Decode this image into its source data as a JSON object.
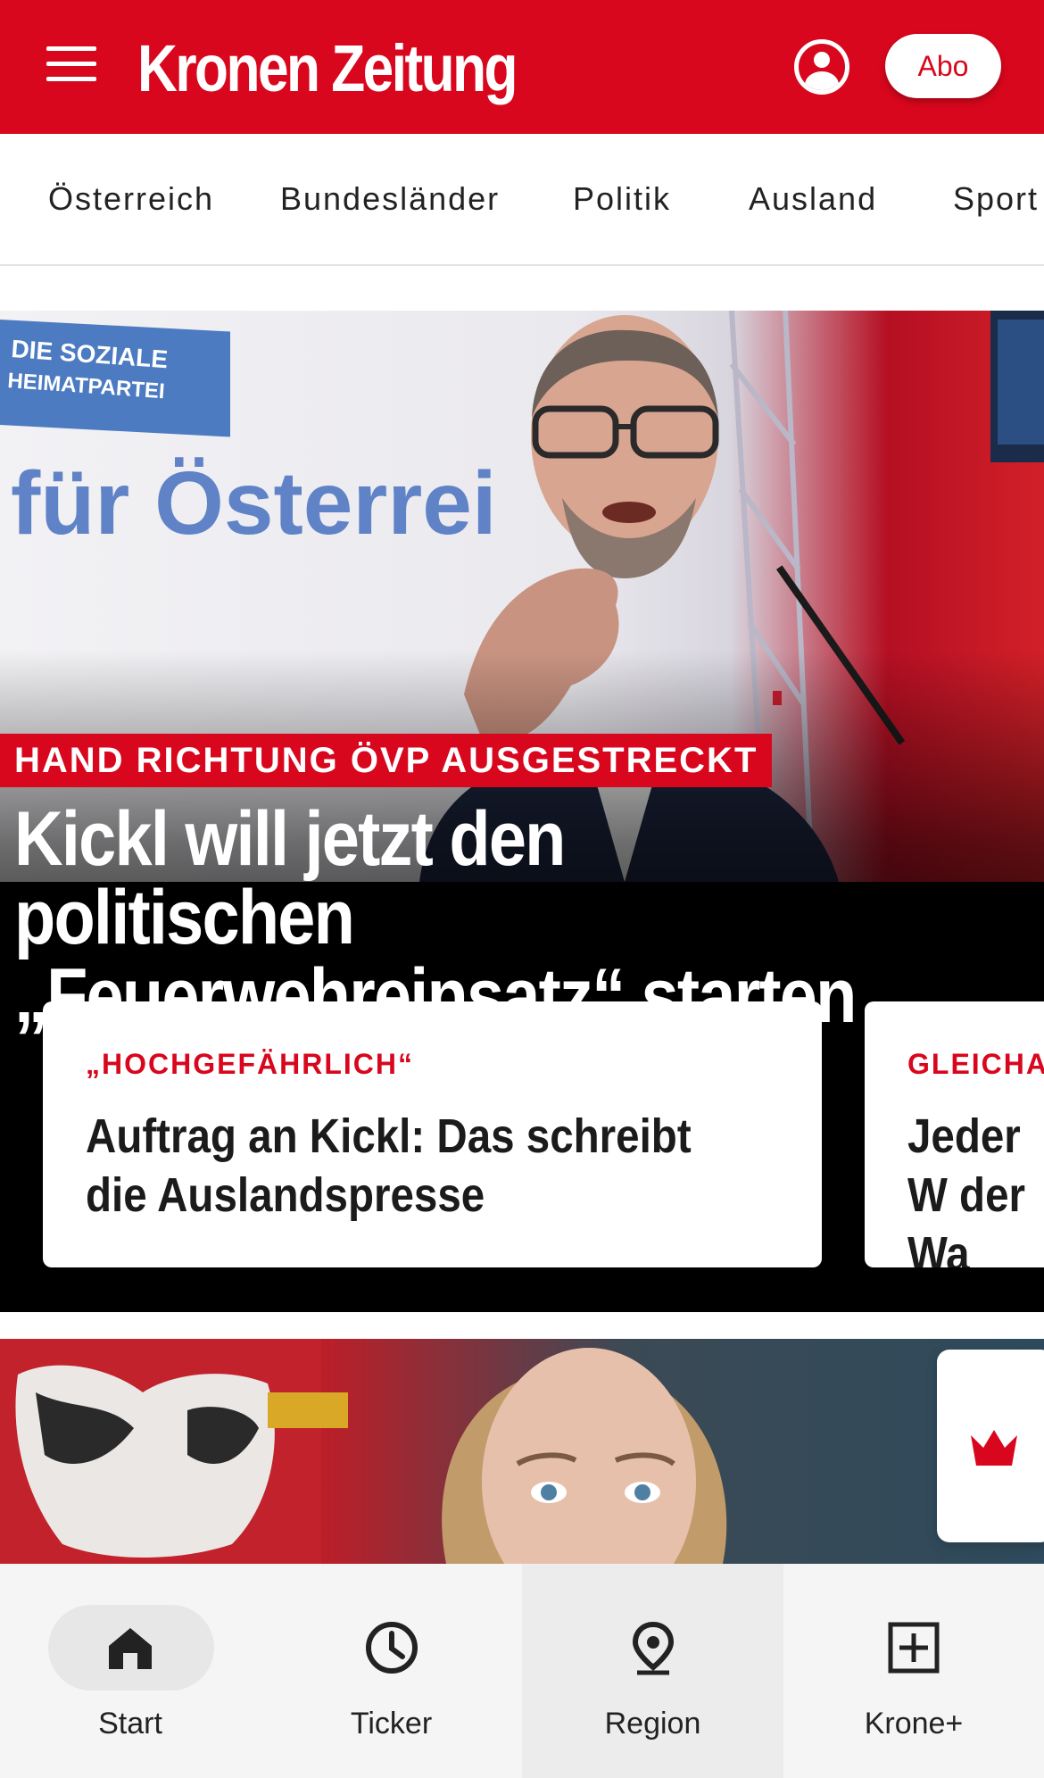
{
  "header": {
    "logo_text": "Kronen Zeitung",
    "abo_label": "Abo",
    "brand_color": "#d8071d"
  },
  "nav": {
    "items": [
      "Österreich",
      "Bundesländer",
      "Politik",
      "Ausland",
      "Sport"
    ]
  },
  "hero": {
    "kicker": "HAND RICHTUNG ÖVP AUSGESTRECKT",
    "title": "Kickl will jetzt den politischen „Feuerwehreinsatz“ starten",
    "image_text_1": "DIE SOZIALE",
    "image_text_2": "HEIMATPARTEI",
    "image_text_3": "für Österrei"
  },
  "cards": [
    {
      "kicker": "„HOCHGEFÄHRLICH“",
      "title": "Auftrag an Kickl: Das schreibt die Auslandspresse"
    },
    {
      "kicker": "GLEICHA",
      "title": "Jeder W der Wa"
    }
  ],
  "bottom_nav": {
    "tabs": [
      {
        "label": "Start",
        "icon": "home-icon",
        "active": true
      },
      {
        "label": "Ticker",
        "icon": "clock-icon",
        "active": false
      },
      {
        "label": "Region",
        "icon": "location-pin-icon",
        "active": false
      },
      {
        "label": "Krone+",
        "icon": "plus-box-icon",
        "active": false
      }
    ]
  }
}
